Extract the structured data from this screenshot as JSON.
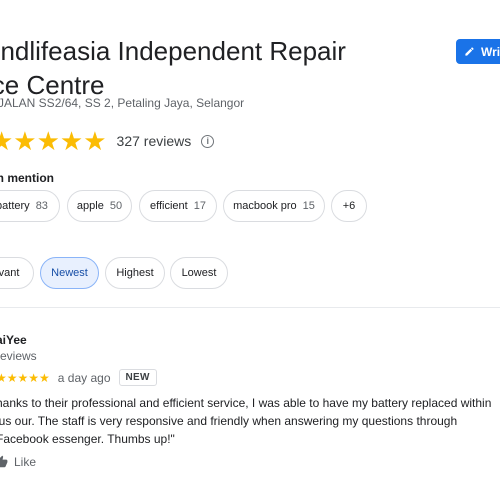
{
  "place": {
    "title_line1": "ondlifeasia Independent Repair",
    "title_line2": "ice Centre",
    "address": "JALAN SS2/64, SS 2, Petaling Jaya, Selangor"
  },
  "write_button": {
    "label": "Writ",
    "icon": "pencil-icon"
  },
  "rating": {
    "stars": "★★★★★",
    "value": 5,
    "review_count": "327 reviews",
    "info_icon": "info-icon"
  },
  "mentions": {
    "label": "en mention",
    "chips": [
      {
        "label": "battery",
        "count": "83"
      },
      {
        "label": "apple",
        "count": "50"
      },
      {
        "label": "efficient",
        "count": "17"
      },
      {
        "label": "macbook pro",
        "count": "15"
      },
      {
        "label": "+6",
        "count": ""
      }
    ]
  },
  "sort": {
    "options": [
      "evant",
      "Newest",
      "Highest",
      "Lowest"
    ],
    "selected": "Newest"
  },
  "review": {
    "name": "aiYee",
    "meta": "reviews",
    "stars": "★★★★★",
    "date": "a day ago",
    "badge": "NEW",
    "text": "hanks to their professional and efficient service, I was able to have my battery replaced within jus our. The staff is very responsive and friendly when answering my questions through Facebook essenger. Thumbs up!\"",
    "like_label": "Like"
  },
  "colors": {
    "accent": "#1a73e8",
    "star": "#fbbc04",
    "selected_chip_bg": "#e8f0fe"
  }
}
